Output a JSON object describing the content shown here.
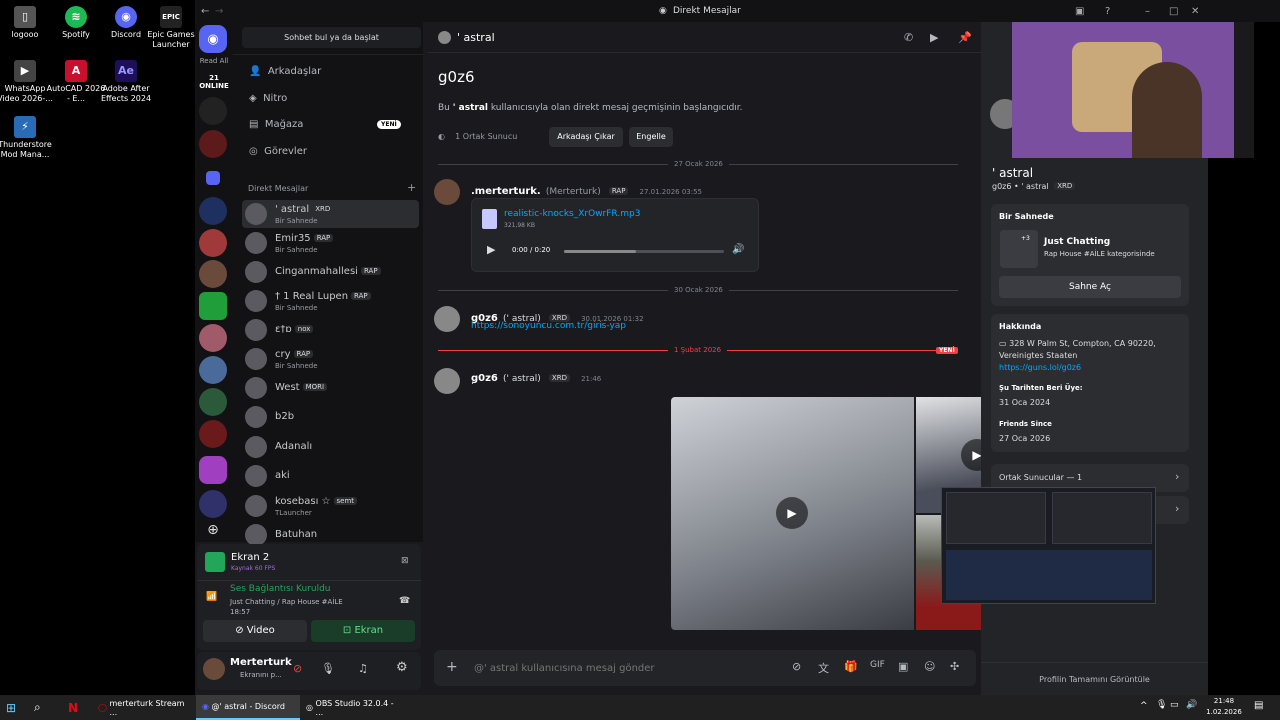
{
  "desktop_icons": [
    {
      "label": "logooo",
      "icon": "generic-file-icon",
      "color": "#555555"
    },
    {
      "label": "Spotify",
      "icon": "spotify-icon",
      "color": "#1db954"
    },
    {
      "label": "Discord",
      "icon": "discord-icon",
      "color": "#5865f2"
    },
    {
      "label": "Epic Games Launcher",
      "icon": "epic-icon",
      "color": "#222222"
    },
    {
      "label": "WhatsApp Video 2026-...",
      "icon": "video-file-icon",
      "color": "#444444"
    },
    {
      "label": "AutoCAD 2026 - E...",
      "icon": "autocad-icon",
      "color": "#c8102e"
    },
    {
      "label": "Adobe After Effects 2024",
      "icon": "after-effects-icon",
      "color": "#1f0f5a"
    },
    {
      "label": "Thunderstore Mod Mana...",
      "icon": "thunderstore-icon",
      "color": "#2a6bb5"
    }
  ],
  "window": {
    "title": "Direkt Mesajlar"
  },
  "servers": {
    "read_all": "Read All",
    "online": "21 ONLINE"
  },
  "dm_sidebar": {
    "search_button": "Sohbet bul ya da başlat",
    "nav": [
      {
        "label": "Arkadaşlar",
        "icon": "friends-icon"
      },
      {
        "label": "Nitro",
        "icon": "nitro-icon"
      },
      {
        "label": "Mağaza",
        "icon": "shop-icon",
        "badge": "YENİ"
      },
      {
        "label": "Görevler",
        "icon": "quests-icon"
      }
    ],
    "section_title": "Direkt Mesajlar",
    "items": [
      {
        "name": "' astral",
        "tag": "XRD",
        "sub": "Bir Sahnede"
      },
      {
        "name": "Emir35",
        "tag": "RAP",
        "sub": "Bir Sahnede"
      },
      {
        "name": "Cinganmahallesi",
        "tag": "RAP",
        "sub": ""
      },
      {
        "name": "† 1 Real Lupen",
        "tag": "RAP",
        "sub": "Bir Sahnede"
      },
      {
        "name": "ɛ†ɒ",
        "tag": "nox",
        "sub": ""
      },
      {
        "name": "cry",
        "tag": "RAP",
        "sub": "Bir Sahnede"
      },
      {
        "name": "West",
        "tag": "MORI",
        "sub": ""
      },
      {
        "name": "b2b",
        "tag": "",
        "sub": ""
      },
      {
        "name": "Adanalı",
        "tag": "",
        "sub": ""
      },
      {
        "name": "aki",
        "tag": "",
        "sub": ""
      },
      {
        "name": "kosebası ☆",
        "tag": "semt",
        "sub": "TLauncher"
      },
      {
        "name": "Batuhan",
        "tag": "",
        "sub": ""
      }
    ]
  },
  "voice_panel": {
    "stream_title": "Ekran 2",
    "stream_sub": "Kaynak 60 FPS",
    "status": "Ses Bağlantısı Kuruldu",
    "channel": "Just Chatting / Rap House #AİLE",
    "timer": "18:57",
    "video_button": "Video",
    "screen_button": "Ekran"
  },
  "user_panel": {
    "name": "Merterturk",
    "status": "Ekranını p..."
  },
  "chat": {
    "header_name": "' astral",
    "intro_big": "' astral",
    "intro_name": "g0z6",
    "intro_text_pre": "Bu",
    "intro_text_user": "' astral",
    "intro_text_post": "kullanıcısıyla olan direkt mesaj geçmişinin başlangıcıdır.",
    "mutual": "1 Ortak Sunucu",
    "remove_friend": "Arkadaşı Çıkar",
    "block": "Engelle",
    "date1": "27 Ocak 2026",
    "date2": "30 Ocak 2026",
    "date3": "1 Şubat 2026",
    "new_badge": "YENİ",
    "msg1": {
      "name": ".merterturk.",
      "alt": "(Merterturk)",
      "tag": "RAP",
      "time": "27.01.2026 03:55",
      "file_name": "realistic-knocks_XrOwrFR.mp3",
      "file_size": "321,98 KB",
      "audio_time": "0:00 / 0:20",
      "audio_progress": 0.45
    },
    "msg2": {
      "name": "g0z6",
      "alt": "(' astral)",
      "tag": "XRD",
      "time": "30.01.2026 01:32",
      "link": "https://sonoyuncu.com.tr/giris-yap"
    },
    "msg3": {
      "name": "g0z6",
      "alt": "(' astral)",
      "tag": "XRD",
      "time": "21:46",
      "text": "."
    },
    "input_placeholder": "@' astral kullanıcısına mesaj gönder"
  },
  "profile": {
    "display_name": "' astral",
    "username": "g0z6",
    "dot_user": "' astral",
    "tag": "XRD",
    "stage_head": "Bir Sahnede",
    "stage_title": "Just Chatting",
    "stage_sub": "Rap House #AİLE kategorisinde",
    "stage_extra": "+3",
    "stage_button": "Sahne Aç",
    "about_head": "Hakkında",
    "about_text": "328 W Palm St, Compton, CA 90220, Vereinigtes Staaten",
    "about_link": "https://guns.lol/g0z6",
    "member_since_head": "Şu Tarihten Beri Üye:",
    "member_since": "31 Oca 2024",
    "friends_since_head": "Friends Since",
    "friends_since": "27 Oca 2026",
    "mutual_servers": "Ortak Sunucular — 1",
    "full_profile": "Profilin Tamamını Görüntüle"
  },
  "taskbar": {
    "items": [
      {
        "label": "merterturk Stream ...",
        "icon": "opera-icon"
      },
      {
        "label": "@' astral - Discord",
        "icon": "discord-icon"
      },
      {
        "label": "OBS Studio 32.0.4 - ...",
        "icon": "obs-icon"
      }
    ],
    "time": "21:48",
    "date": "1.02.2026"
  }
}
